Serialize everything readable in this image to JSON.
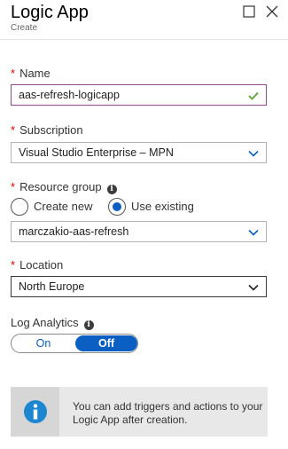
{
  "header": {
    "title": "Logic App",
    "subtitle": "Create",
    "icons": [
      "maximize-icon",
      "close-icon"
    ]
  },
  "name_field": {
    "label": "Name",
    "value": "aas-refresh-logicapp",
    "valid_icon": "check-icon"
  },
  "subscription": {
    "label": "Subscription",
    "value": "Visual Studio Enterprise – MPN"
  },
  "resource_group": {
    "label": "Resource group",
    "options": {
      "create_new": "Create new",
      "use_existing": "Use existing"
    },
    "selected_option": "use_existing",
    "value": "marczakio-aas-refresh"
  },
  "location": {
    "label": "Location",
    "value": "North Europe"
  },
  "log_analytics": {
    "label": "Log Analytics",
    "on_label": "On",
    "off_label": "Off",
    "selected": "Off"
  },
  "info": {
    "text": "You can add triggers and actions to your Logic App after creation."
  },
  "colors": {
    "accent": "#0b5fc3",
    "required": "#e00000",
    "valid": "#5aa531",
    "focus_border": "#8b4a8b"
  }
}
